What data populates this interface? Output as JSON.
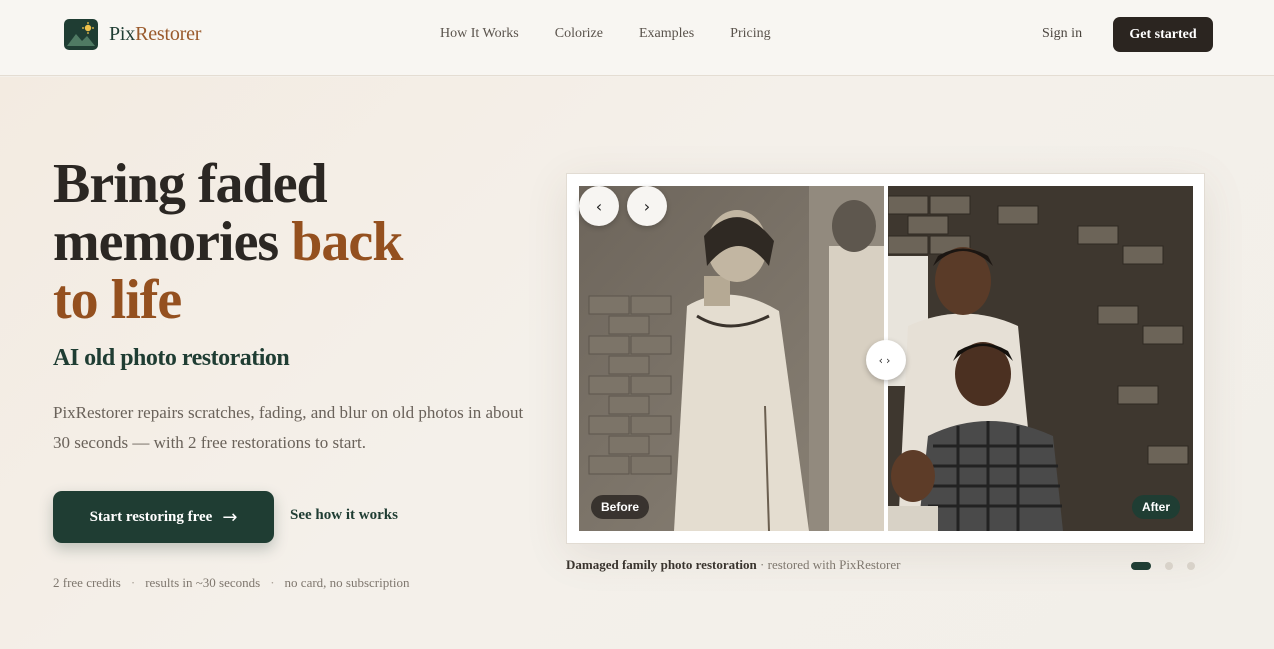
{
  "brand": {
    "name_part1": "Pix",
    "name_part2": "Restorer"
  },
  "nav": {
    "items": [
      "How It Works",
      "Colorize",
      "Examples",
      "Pricing"
    ],
    "sign_in": "Sign in",
    "get_started": "Get started"
  },
  "hero": {
    "headline_line1": "Bring faded",
    "headline_line2a": "memories ",
    "headline_line2b": "back",
    "headline_line3": "to life",
    "subhead": "AI old photo restoration",
    "description": "PixRestorer repairs scratches, fading, and blur on old photos in about 30 seconds — with 2 free restorations to start.",
    "cta_primary": "Start restoring free",
    "cta_secondary": "See how it works",
    "meta": [
      "2 free credits",
      "results in ~30 seconds",
      "no card, no subscription"
    ]
  },
  "comparison": {
    "before_label": "Before",
    "after_label": "After",
    "caption_title": "Damaged family photo restoration",
    "caption_suffix": " · restored with PixRestorer",
    "slide_count": 3,
    "active_slide": 1
  },
  "colors": {
    "brand_green": "#1f3d33",
    "accent_brown": "#94501f",
    "dark_button": "#2b2520"
  },
  "icons": [
    "arrow-right-icon",
    "chevron-left-icon",
    "chevron-right-icon",
    "compare-handle-icon"
  ]
}
